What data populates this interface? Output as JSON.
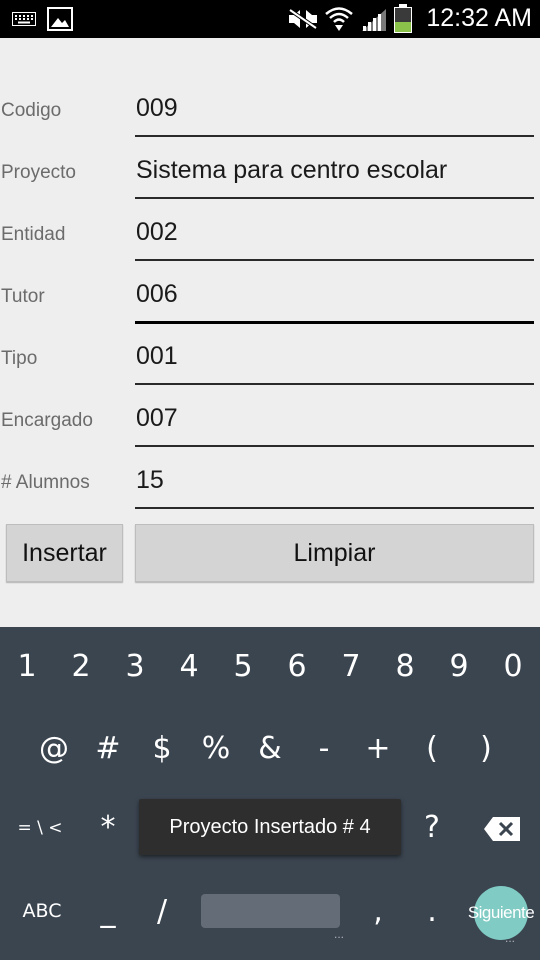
{
  "status_bar": {
    "time": "12:32 AM",
    "icons": [
      "keyboard-icon",
      "image-icon",
      "mute-icon",
      "wifi-icon",
      "signal-icon",
      "battery-icon"
    ]
  },
  "form": {
    "fields": [
      {
        "label": "Codigo",
        "value": "009"
      },
      {
        "label": "Proyecto",
        "value": "Sistema para centro escolar"
      },
      {
        "label": "Entidad",
        "value": "002"
      },
      {
        "label": "Tutor",
        "value": "006"
      },
      {
        "label": "Tipo",
        "value": "001"
      },
      {
        "label": "Encargado",
        "value": "007"
      },
      {
        "label": "# Alumnos",
        "value": "15"
      }
    ],
    "insert_label": "Insertar",
    "clear_label": "Limpiar"
  },
  "keyboard": {
    "row1": [
      "1",
      "2",
      "3",
      "4",
      "5",
      "6",
      "7",
      "8",
      "9",
      "0"
    ],
    "row2": [
      "@",
      "#",
      "$",
      "%",
      "&",
      "-",
      "+",
      "(",
      ")"
    ],
    "row3": [
      "= \\ <",
      "*",
      "?"
    ],
    "row4": [
      "ABC",
      "_",
      "/",
      ",",
      "."
    ],
    "next_label": "Siguiente",
    "dots": "..."
  },
  "toast": {
    "message": "Proyecto Insertado # 4"
  }
}
